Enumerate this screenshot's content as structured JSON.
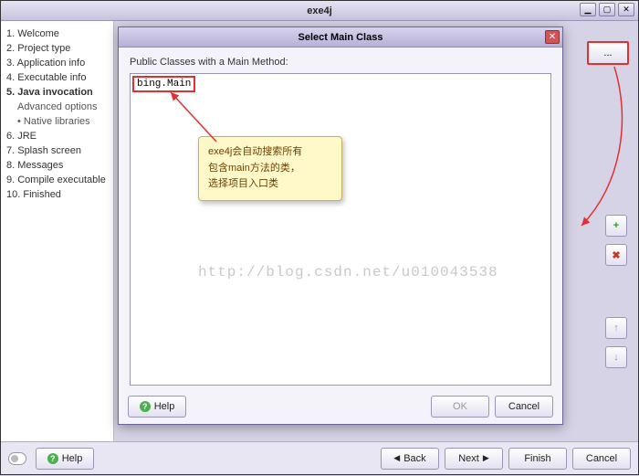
{
  "window": {
    "title": "exe4j"
  },
  "steps": [
    "1. Welcome",
    "2. Project type",
    "3. Application info",
    "4. Executable info",
    "5. Java invocation",
    "Advanced options",
    "Native libraries",
    "6. JRE",
    "7. Splash screen",
    "8. Messages",
    "9. Compile executable",
    "10. Finished"
  ],
  "current_step_index": 4,
  "modal": {
    "title": "Select Main Class",
    "label": "Public Classes with a Main Method:",
    "list_item": "bing.Main",
    "help": "Help",
    "ok": "OK",
    "cancel": "Cancel"
  },
  "bottombar": {
    "help": "Help",
    "back": "Back",
    "next": "Next",
    "finish": "Finish",
    "cancel": "Cancel"
  },
  "browse_label": "...",
  "callout": {
    "line1": "exe4j会自动搜索所有",
    "line2": "包含main方法的类，",
    "line3": "选择项目入口类"
  },
  "watermark": "http://blog.csdn.net/u010043538",
  "icons": {
    "add": "+",
    "delete": "✖",
    "up": "↑",
    "down": "↓"
  }
}
